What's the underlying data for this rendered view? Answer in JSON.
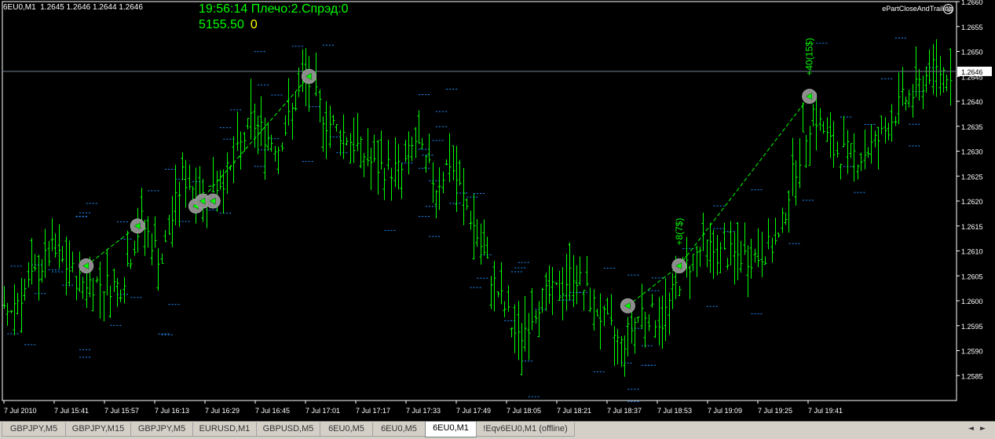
{
  "chart": {
    "header": "6EU0,M1  1.2645 1.2646 1.2644 1.2646",
    "info_line1": "19:56:14 Плечо:2.Спрэд:0",
    "equity": "5155.50",
    "zero": "0",
    "ea_name": "ePartCloseAndTrailing",
    "smiley": "☺",
    "annotations": [
      "+8(7$)",
      "+40(15$)"
    ]
  },
  "tabs": [
    {
      "label": "GBPJPY,M5",
      "active": false
    },
    {
      "label": "GBPJPY,M15",
      "active": false
    },
    {
      "label": "GBPJPY,M5",
      "active": false
    },
    {
      "label": "EURUSD,M1",
      "active": false
    },
    {
      "label": "GBPUSD,M5",
      "active": false
    },
    {
      "label": "6EU0,M5",
      "active": false
    },
    {
      "label": "6EU0,M5",
      "active": false
    },
    {
      "label": "6EU0,M1",
      "active": true
    },
    {
      "label": "!Eqv6EU0,M1 (offline)",
      "active": false
    }
  ],
  "colors": {
    "background": "#000000",
    "bars": "#00ff00",
    "levels": "#1e90ff",
    "grid_text": "#ffffff",
    "current_price_line": "#708090"
  },
  "chart_data": {
    "type": "bar",
    "symbol": "6EU0",
    "timeframe": "M1",
    "current_price": 1.2646,
    "ylim": [
      1.258,
      1.266
    ],
    "y_ticks": [
      "1.2660",
      "1.2655",
      "1.2650",
      "1.2645",
      "1.2640",
      "1.2635",
      "1.2630",
      "1.2625",
      "1.2620",
      "1.2615",
      "1.2610",
      "1.2605",
      "1.2600",
      "1.2595",
      "1.2590",
      "1.2585"
    ],
    "x_ticks": [
      "7 Jul 2010",
      "7 Jul 15:41",
      "7 Jul 15:57",
      "7 Jul 16:13",
      "7 Jul 16:29",
      "7 Jul 16:45",
      "7 Jul 17:01",
      "7 Jul 17:17",
      "7 Jul 17:33",
      "7 Jul 17:49",
      "7 Jul 18:05",
      "7 Jul 18:21",
      "7 Jul 18:37",
      "7 Jul 18:53",
      "7 Jul 19:09",
      "7 Jul 19:25",
      "7 Jul 19:41"
    ],
    "close_path": [
      {
        "bar": 0,
        "price": 1.2597
      },
      {
        "bar": 8,
        "price": 1.2604
      },
      {
        "bar": 14,
        "price": 1.261
      },
      {
        "bar": 22,
        "price": 1.2604
      },
      {
        "bar": 34,
        "price": 1.2603
      },
      {
        "bar": 40,
        "price": 1.2616
      },
      {
        "bar": 46,
        "price": 1.2608
      },
      {
        "bar": 52,
        "price": 1.2625
      },
      {
        "bar": 58,
        "price": 1.2621
      },
      {
        "bar": 66,
        "price": 1.2626
      },
      {
        "bar": 72,
        "price": 1.2636
      },
      {
        "bar": 80,
        "price": 1.2631
      },
      {
        "bar": 88,
        "price": 1.2645
      },
      {
        "bar": 94,
        "price": 1.2636
      },
      {
        "bar": 100,
        "price": 1.2633
      },
      {
        "bar": 108,
        "price": 1.2627
      },
      {
        "bar": 116,
        "price": 1.2626
      },
      {
        "bar": 120,
        "price": 1.2632
      },
      {
        "bar": 126,
        "price": 1.2623
      },
      {
        "bar": 130,
        "price": 1.2628
      },
      {
        "bar": 136,
        "price": 1.2617
      },
      {
        "bar": 142,
        "price": 1.2605
      },
      {
        "bar": 150,
        "price": 1.2592
      },
      {
        "bar": 156,
        "price": 1.26
      },
      {
        "bar": 162,
        "price": 1.2602
      },
      {
        "bar": 166,
        "price": 1.2606
      },
      {
        "bar": 172,
        "price": 1.2599
      },
      {
        "bar": 180,
        "price": 1.2591
      },
      {
        "bar": 186,
        "price": 1.2598
      },
      {
        "bar": 192,
        "price": 1.2596
      },
      {
        "bar": 198,
        "price": 1.2606
      },
      {
        "bar": 204,
        "price": 1.2611
      },
      {
        "bar": 210,
        "price": 1.2609
      },
      {
        "bar": 220,
        "price": 1.2609
      },
      {
        "bar": 226,
        "price": 1.2612
      },
      {
        "bar": 230,
        "price": 1.2625
      },
      {
        "bar": 236,
        "price": 1.2638
      },
      {
        "bar": 242,
        "price": 1.263
      },
      {
        "bar": 250,
        "price": 1.2629
      },
      {
        "bar": 256,
        "price": 1.2633
      },
      {
        "bar": 262,
        "price": 1.264
      },
      {
        "bar": 266,
        "price": 1.2642
      },
      {
        "bar": 270,
        "price": 1.2646
      }
    ],
    "trades": [
      {
        "from": {
          "bar": 24,
          "price": 1.2607
        },
        "to": {
          "bar": 39,
          "price": 1.2615
        }
      },
      {
        "from": {
          "bar": 56,
          "price": 1.2619
        },
        "to": {
          "bar": 89,
          "price": 1.2645
        }
      },
      {
        "from": {
          "bar": 182,
          "price": 1.2599
        },
        "to": {
          "bar": 197,
          "price": 1.2607
        },
        "label": "+8(7$)"
      },
      {
        "from": {
          "bar": 197,
          "price": 1.2607
        },
        "to": {
          "bar": 235,
          "price": 1.2641
        },
        "label": "+40(15$)"
      }
    ],
    "markers": [
      {
        "bar": 24,
        "price": 1.2607
      },
      {
        "bar": 39,
        "price": 1.2615
      },
      {
        "bar": 56,
        "price": 1.2619
      },
      {
        "bar": 58,
        "price": 1.262
      },
      {
        "bar": 61,
        "price": 1.262
      },
      {
        "bar": 89,
        "price": 1.2645
      },
      {
        "bar": 182,
        "price": 1.2599
      },
      {
        "bar": 197,
        "price": 1.2607
      },
      {
        "bar": 235,
        "price": 1.2641
      }
    ]
  }
}
